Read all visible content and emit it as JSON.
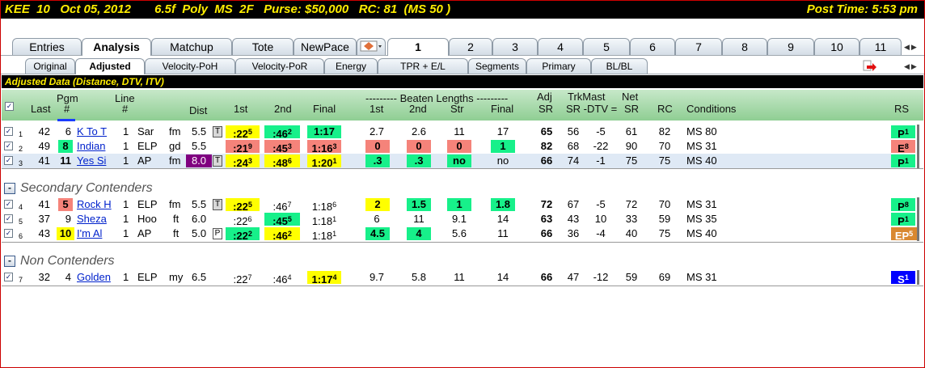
{
  "title": {
    "left": "KEE  10   Oct 05, 2012       6.5f  Poly  MS  2F   Purse: $50,000   RC: 81  (MS 50 )",
    "right": "Post Time: 5:53 pm"
  },
  "tabs_main": [
    {
      "label": "Entries"
    },
    {
      "label": "Analysis",
      "active": true
    },
    {
      "label": "Matchup"
    },
    {
      "label": "Tote"
    },
    {
      "label": "NewPace"
    }
  ],
  "tabs_race": [
    "1",
    "2",
    "3",
    "4",
    "5",
    "6",
    "7",
    "8",
    "9",
    "10",
    "11"
  ],
  "tabs_sub": [
    {
      "label": "Original"
    },
    {
      "label": "Adjusted",
      "active": true
    },
    {
      "label": "Velocity-PoH"
    },
    {
      "label": "Velocity-PoR"
    },
    {
      "label": "Energy"
    },
    {
      "label": "TPR + E/L"
    },
    {
      "label": "Segments"
    },
    {
      "label": "Primary"
    },
    {
      "label": "BL/BL"
    }
  ],
  "data_header": "Adjusted Data (Distance, DTV, ITV)",
  "columns": {
    "last": "Last",
    "pgm_top": "Pgm",
    "pgm_bot": "#",
    "line_top": "Line",
    "line_bot": "#",
    "dist": "Dist",
    "first": "1st",
    "second": "2nd",
    "final": "Final",
    "beaten_title": "--------- Beaten Lengths ---------",
    "bl_first": "1st",
    "bl_second": "2nd",
    "bl_str": "Str",
    "bl_final": "Final",
    "adj_top": "Adj",
    "adj_bot": "SR",
    "trk_top": "TrkMast",
    "trk_bot": "SR -DTV =",
    "net_top": "Net",
    "net_bot": "SR",
    "rc": "RC",
    "conditions": "Conditions",
    "rs": "RS"
  },
  "sections": {
    "secondary": "Secondary Contenders",
    "non": "Non Contenders"
  },
  "rows": [
    {
      "idx": "1",
      "last": "42",
      "pgm": "6",
      "name": "K To T",
      "line": "1",
      "trk": "Sar",
      "cond": "fm",
      "dist": "5.5",
      "tag": "T",
      "first": ":22",
      "first_sup": "5",
      "second": ":46",
      "second_sup": "2",
      "final": "1:17",
      "final_sup": "",
      "bl1": "2.7",
      "bl2": "2.6",
      "blstr": "11",
      "blfin": "17",
      "adj": "65",
      "sr": "56",
      "dtv": "-5",
      "net": "61",
      "rc": "82",
      "conditions": "MS 80",
      "rs": "P",
      "rs_sup": "1"
    },
    {
      "idx": "2",
      "last": "49",
      "pgm": "8",
      "name": "Indian",
      "line": "1",
      "trk": "ELP",
      "cond": "gd",
      "dist": "5.5",
      "tag": "",
      "first": ":21",
      "first_sup": "9",
      "second": ":45",
      "second_sup": "3",
      "final": "1:16",
      "final_sup": "3",
      "bl1": "0",
      "bl2": "0",
      "blstr": "0",
      "blfin": "1",
      "adj": "82",
      "sr": "68",
      "dtv": "-22",
      "net": "90",
      "rc": "70",
      "conditions": "MS 31",
      "rs": "E",
      "rs_sup": "8"
    },
    {
      "idx": "3",
      "last": "41",
      "pgm": "11",
      "name": "Yes Si",
      "line": "1",
      "trk": "AP",
      "cond": "fm",
      "dist": "8.0",
      "tag": "T",
      "first": ":24",
      "first_sup": "3",
      "second": ":48",
      "second_sup": "6",
      "final": "1:20",
      "final_sup": "1",
      "bl1": ".3",
      "bl2": ".3",
      "blstr": "no",
      "blfin": "no",
      "adj": "66",
      "sr": "74",
      "dtv": "-1",
      "net": "75",
      "rc": "75",
      "conditions": "MS 40",
      "rs": "P",
      "rs_sup": "1"
    },
    {
      "idx": "4",
      "last": "41",
      "pgm": "5",
      "name": "Rock H",
      "line": "1",
      "trk": "ELP",
      "cond": "fm",
      "dist": "5.5",
      "tag": "T",
      "first": ":22",
      "first_sup": "5",
      "second": ":46",
      "second_sup": "7",
      "final": "1:18",
      "final_sup": "6",
      "bl1": "2",
      "bl2": "1.5",
      "blstr": "1",
      "blfin": "1.8",
      "adj": "72",
      "sr": "67",
      "dtv": "-5",
      "net": "72",
      "rc": "70",
      "conditions": "MS 31",
      "rs": "P",
      "rs_sup": "8"
    },
    {
      "idx": "5",
      "last": "37",
      "pgm": "9",
      "name": "Sheza",
      "line": "1",
      "trk": "Hoo",
      "cond": "ft",
      "dist": "6.0",
      "tag": "",
      "first": ":22",
      "first_sup": "6",
      "second": ":45",
      "second_sup": "5",
      "final": "1:18",
      "final_sup": "1",
      "bl1": "6",
      "bl2": "11",
      "blstr": "9.1",
      "blfin": "14",
      "adj": "63",
      "sr": "43",
      "dtv": "10",
      "net": "33",
      "rc": "59",
      "conditions": "MS 35",
      "rs": "P",
      "rs_sup": "1"
    },
    {
      "idx": "6",
      "last": "43",
      "pgm": "10",
      "name": "I'm Al",
      "line": "1",
      "trk": "AP",
      "cond": "ft",
      "dist": "5.0",
      "tag": "P",
      "first": ":22",
      "first_sup": "2",
      "second": ":46",
      "second_sup": "2",
      "final": "1:18",
      "final_sup": "1",
      "bl1": "4.5",
      "bl2": "4",
      "blstr": "5.6",
      "blfin": "11",
      "adj": "66",
      "sr": "36",
      "dtv": "-4",
      "net": "40",
      "rc": "75",
      "conditions": "MS 40",
      "rs": "EP",
      "rs_sup": "5"
    },
    {
      "idx": "7",
      "last": "32",
      "pgm": "4",
      "name": "Golden",
      "line": "1",
      "trk": "ELP",
      "cond": "my",
      "dist": "6.5",
      "tag": "",
      "first": ":22",
      "first_sup": "7",
      "second": ":46",
      "second_sup": "4",
      "final": "1:17",
      "final_sup": "4",
      "bl1": "9.7",
      "bl2": "5.8",
      "blstr": "11",
      "blfin": "14",
      "adj": "66",
      "sr": "47",
      "dtv": "-12",
      "net": "59",
      "rc": "69",
      "conditions": "MS 31",
      "rs": "S",
      "rs_sup": "1"
    }
  ],
  "colors": {
    "green": "#17f08a",
    "yellow": "#ffff00",
    "red": "#f5837a",
    "purple": "#800080",
    "orange": "#d9882f",
    "blue": "#0000ff",
    "title_text": "#ffee00"
  },
  "icons": {
    "tab_icon": "diamond-horse-icon",
    "row_checkbox": "checkbox-checked-icon",
    "collapse": "minus-collapse-icon",
    "export": "red-arrow-icon"
  }
}
